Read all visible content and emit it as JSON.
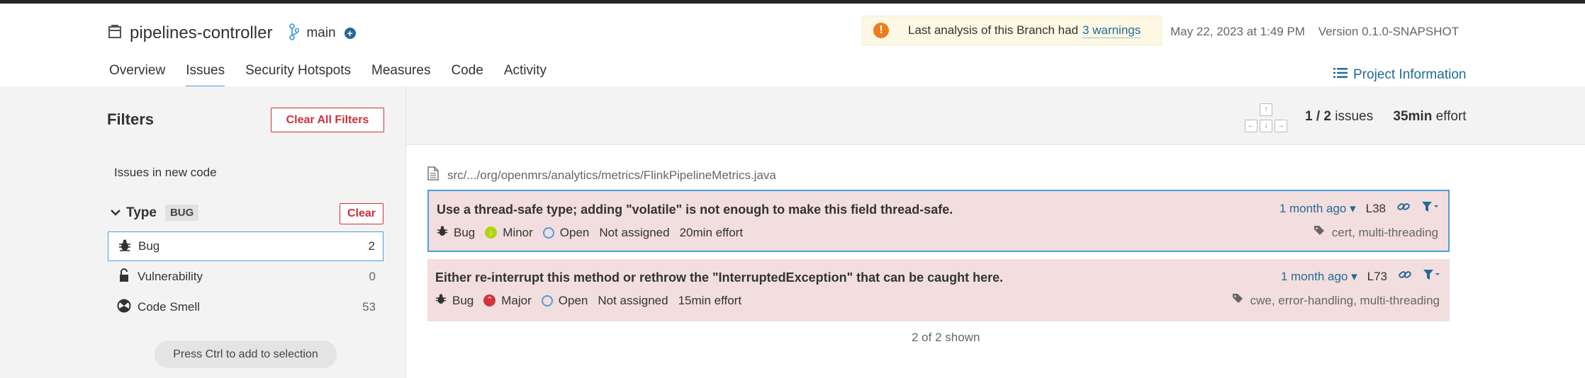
{
  "project": {
    "name": "pipelines-controller",
    "branch": "main"
  },
  "warning": {
    "text": "Last analysis of this Branch had",
    "link": "3 warnings"
  },
  "meta": {
    "date": "May 22, 2023 at 1:49 PM",
    "version": "Version 0.1.0-SNAPSHOT"
  },
  "nav": {
    "tabs": [
      {
        "label": "Overview"
      },
      {
        "label": "Issues"
      },
      {
        "label": "Security Hotspots"
      },
      {
        "label": "Measures"
      },
      {
        "label": "Code"
      },
      {
        "label": "Activity"
      }
    ],
    "project_info": "Project Information"
  },
  "filters": {
    "title": "Filters",
    "clear_all": "Clear All Filters",
    "new_code": "Issues in new code",
    "type": {
      "label": "Type",
      "badge": "BUG",
      "clear": "Clear",
      "items": [
        {
          "label": "Bug",
          "count": "2",
          "icon": "bug-icon"
        },
        {
          "label": "Vulnerability",
          "count": "0",
          "icon": "lock-open-icon"
        },
        {
          "label": "Code Smell",
          "count": "53",
          "icon": "code-smell-icon"
        }
      ]
    },
    "hint": "Press Ctrl to add to selection"
  },
  "toolbar": {
    "keys": {
      "up": "↑",
      "left": "←",
      "down": "↓",
      "right": "→"
    },
    "count": "1 / 2",
    "count_suffix": "issues",
    "effort": "35min",
    "effort_suffix": "effort"
  },
  "file": {
    "path": "src/.../org/openmrs/analytics/metrics/FlinkPipelineMetrics.java"
  },
  "issues": [
    {
      "message": "Use a thread-safe type; adding \"volatile\" is not enough to make this field thread-safe.",
      "age": "1 month ago",
      "line": "L38",
      "type": "Bug",
      "severity": "Minor",
      "status": "Open",
      "assignee": "Not assigned",
      "effort": "20min effort",
      "tags": "cert, multi-threading"
    },
    {
      "message": "Either re-interrupt this method or rethrow the \"InterruptedException\" that can be caught here.",
      "age": "1 month ago",
      "line": "L73",
      "type": "Bug",
      "severity": "Major",
      "status": "Open",
      "assignee": "Not assigned",
      "effort": "15min effort",
      "tags": "cwe, error-handling, multi-threading"
    }
  ],
  "shown": "2 of 2 shown",
  "colors": {
    "accent": "#236a97",
    "issue_bg": "#f2dede",
    "danger": "#d02f3a",
    "selection": "#4b9fd5"
  }
}
